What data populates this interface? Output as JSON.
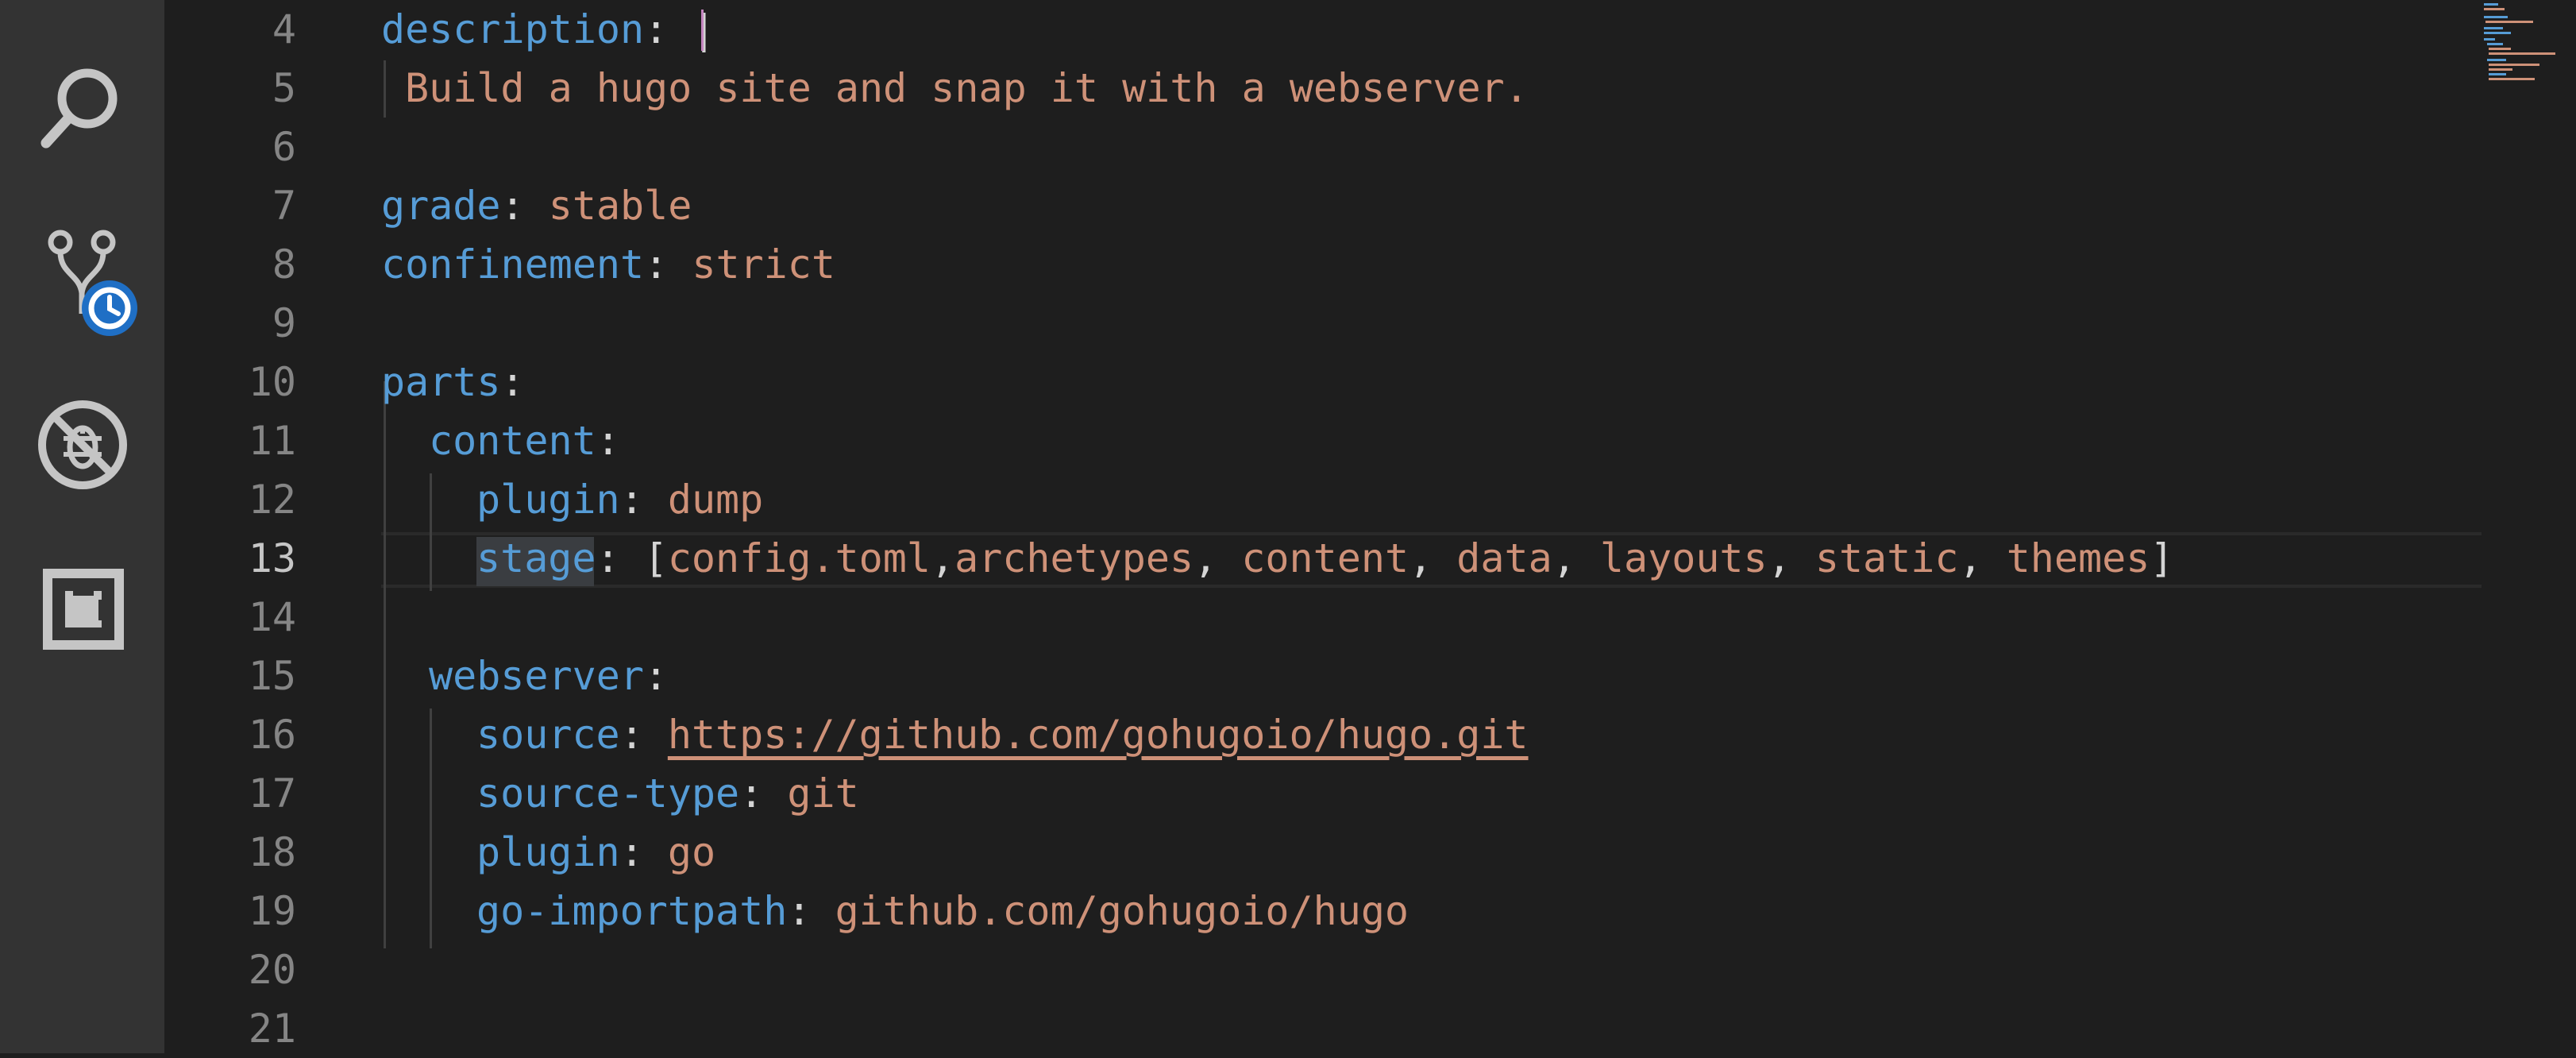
{
  "activity_bar": {
    "items": [
      {
        "name": "search",
        "icon": "search-icon"
      },
      {
        "name": "source-control",
        "icon": "source-control-history-icon"
      },
      {
        "name": "debug",
        "icon": "debug-disabled-icon"
      },
      {
        "name": "extensions",
        "icon": "extensions-icon"
      }
    ]
  },
  "editor": {
    "active_line": "13",
    "line_numbers": [
      "4",
      "5",
      "6",
      "7",
      "8",
      "9",
      "10",
      "11",
      "12",
      "13",
      "14",
      "15",
      "16",
      "17",
      "18",
      "19",
      "20",
      "21"
    ],
    "lines": {
      "l4_key": "description",
      "l4_punct": ": |",
      "l5_text": "Build a hugo site and snap it with a webserver.",
      "l7_key": "grade",
      "l7_punct": ": ",
      "l7_val": "stable",
      "l8_key": "confinement",
      "l8_punct": ": ",
      "l8_val": "strict",
      "l10_key": "parts",
      "l10_punct": ":",
      "l11_key": "content",
      "l11_punct": ":",
      "l12_key": "plugin",
      "l12_punct": ": ",
      "l12_val": "dump",
      "l13_key": "stage",
      "l13_open": ": [",
      "l13_v1": "config.toml",
      "l13_c1": ",",
      "l13_v2": "archetypes",
      "l13_c2": ", ",
      "l13_v3": "content",
      "l13_c3": ", ",
      "l13_v4": "data",
      "l13_c4": ", ",
      "l13_v5": "layouts",
      "l13_c5": ", ",
      "l13_v6": "static",
      "l13_c6": ", ",
      "l13_v7": "themes",
      "l13_close": "]",
      "l15_key": "webserver",
      "l15_punct": ":",
      "l16_key": "source",
      "l16_punct": ": ",
      "l16_val": "https://github.com/gohugoio/hugo.git",
      "l17_key": "source-type",
      "l17_punct": ": ",
      "l17_val": "git",
      "l18_key": "plugin",
      "l18_punct": ": ",
      "l18_val": "go",
      "l19_key": "go-importpath",
      "l19_punct": ": ",
      "l19_val": "github.com/gohugoio/hugo"
    }
  },
  "colors": {
    "key": "#569cd6",
    "string": "#ce9178",
    "punct": "#d4d4d4",
    "background": "#1e1e1e",
    "activity_bar": "#333333",
    "badge": "#1f6fc5"
  }
}
